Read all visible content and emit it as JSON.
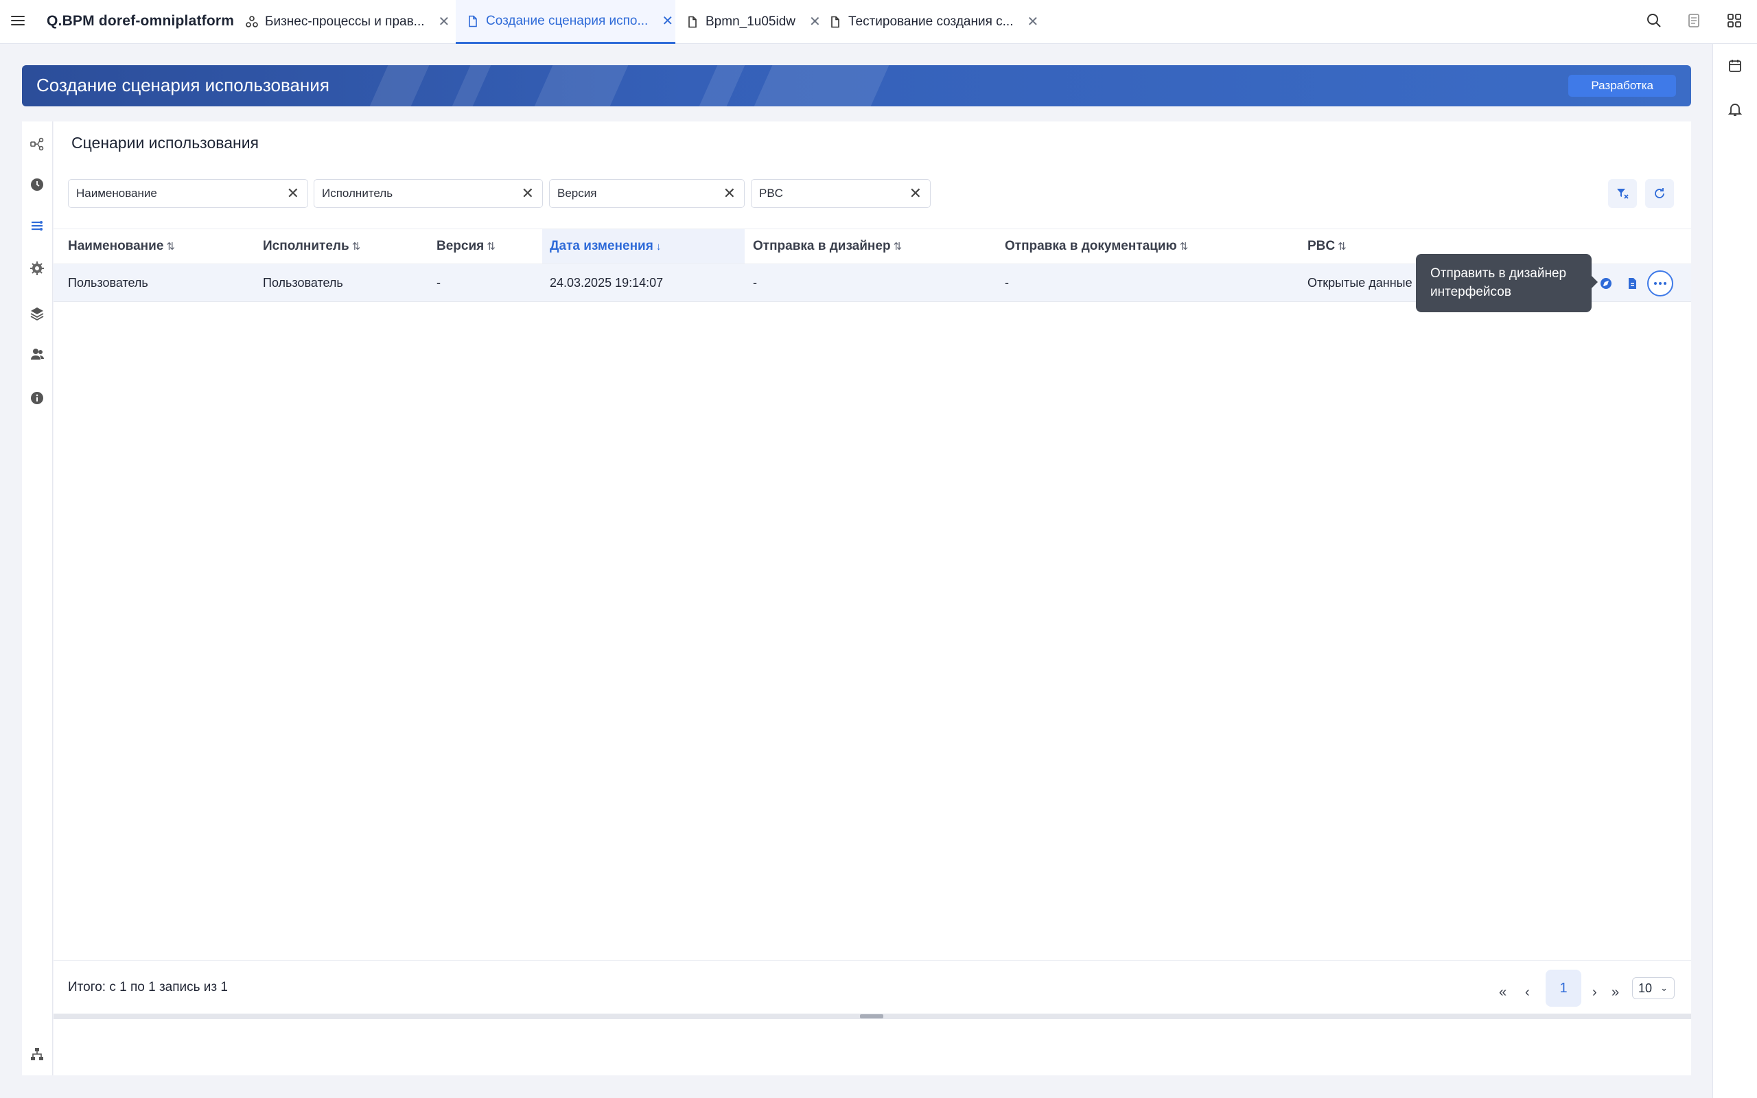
{
  "app": {
    "title": "Q.BPM doref-omniplatform"
  },
  "tabs": [
    {
      "label": "Бизнес-процессы и прав...",
      "icon": "process-network-icon"
    },
    {
      "label": "Создание сценария испо...",
      "icon": "document-icon",
      "active": true
    },
    {
      "label": "Bpmn_1u05idw",
      "icon": "document-icon"
    },
    {
      "label": "Тестирование создания с...",
      "icon": "document-icon"
    }
  ],
  "banner": {
    "title": "Создание сценария использования",
    "badge": "Разработка"
  },
  "panel": {
    "title": "Сценарии использования"
  },
  "filters": [
    {
      "label": "Наименование"
    },
    {
      "label": "Исполнитель"
    },
    {
      "label": "Версия"
    },
    {
      "label": "PBC"
    }
  ],
  "table": {
    "columns": [
      "Наименование",
      "Исполнитель",
      "Версия",
      "Дата изменения",
      "Отправка в дизайнер",
      "Отправка в документацию",
      "PBC"
    ],
    "sorted_column": "Дата изменения",
    "rows": [
      [
        "Пользователь",
        "Пользователь",
        "-",
        "24.03.2025 19:14:07",
        "-",
        "-",
        "Открытые данные"
      ]
    ]
  },
  "tooltip": {
    "line1": "Отправить в дизайнер",
    "line2": "интерфейсов"
  },
  "footer": {
    "total": "Итого: с 1 по 1 запись из 1",
    "current_page": "1",
    "page_size": "10"
  },
  "colors": {
    "accent": "#2f6bd8",
    "banner": "#3560b8",
    "tooltip": "#444a55"
  }
}
